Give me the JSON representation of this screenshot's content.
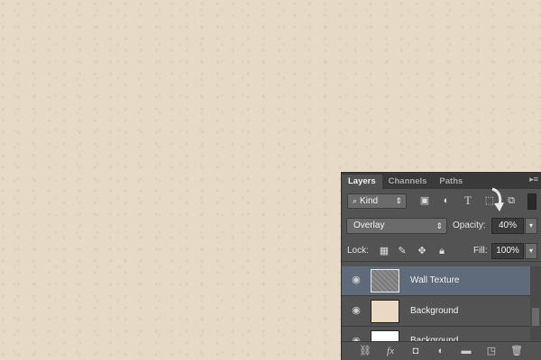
{
  "layers_panel": {
    "tabs": [
      {
        "label": "Layers",
        "active": true
      },
      {
        "label": "Channels",
        "active": false
      },
      {
        "label": "Paths",
        "active": false
      }
    ],
    "filter": {
      "kind_label": "Kind"
    },
    "blend_mode": "Overlay",
    "opacity_label": "Opacity:",
    "opacity_value": "40%",
    "lock_label": "Lock:",
    "fill_label": "Fill:",
    "fill_value": "100%",
    "layers": [
      {
        "name": "Wall Texture",
        "selected": true,
        "thumb": "texture"
      },
      {
        "name": "Background",
        "selected": false,
        "thumb": "beige"
      },
      {
        "name": "Background",
        "selected": false,
        "thumb": "white"
      }
    ]
  },
  "colors": {
    "canvas": "#e6dac6",
    "panel": "#535353",
    "selection": "#5f6b7b"
  },
  "icons": [
    "search-icon",
    "image-filter-icon",
    "adjustment-filter-icon",
    "type-filter-icon",
    "shape-filter-icon",
    "smart-object-filter-icon",
    "lock-transparent-icon",
    "lock-paint-icon",
    "lock-move-icon",
    "lock-all-icon",
    "eye-icon",
    "link-icon",
    "fx-icon",
    "mask-icon",
    "adjustment-icon",
    "folder-icon",
    "new-layer-icon",
    "trash-icon",
    "panel-menu-icon"
  ]
}
